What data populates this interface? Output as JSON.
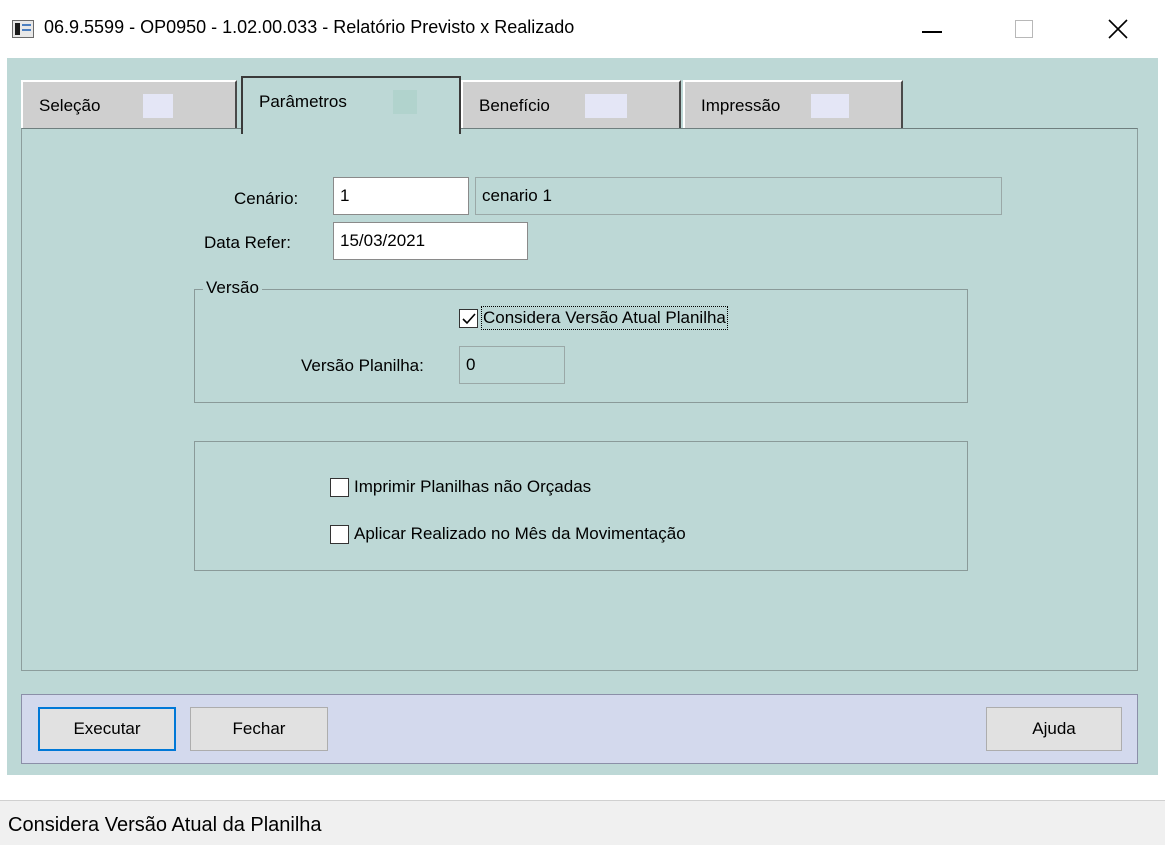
{
  "window": {
    "title": "06.9.5599 - OP0950 - 1.02.00.033 - Relatório Previsto x Realizado",
    "icon": "app-window-icon",
    "controls": [
      "minimize-icon",
      "maximize-icon",
      "close-icon"
    ]
  },
  "tabs": [
    {
      "label": "Seleção",
      "active": false
    },
    {
      "label": "Parâmetros",
      "active": true
    },
    {
      "label": "Benefício",
      "active": false
    },
    {
      "label": "Impressão",
      "active": false
    }
  ],
  "form": {
    "cenario_label": "Cenário:",
    "cenario_value": "1",
    "cenario_desc": "cenario 1",
    "data_refer_label": "Data Refer:",
    "data_refer_value": "15/03/2021"
  },
  "versao_group": {
    "legend": "Versão",
    "considera_label": "Considera Versão Atual Planilha",
    "considera_checked": true,
    "versao_planilha_label": "Versão Planilha:",
    "versao_planilha_value": "0"
  },
  "options_group": {
    "imprimir_label": "Imprimir Planilhas não Orçadas",
    "imprimir_checked": false,
    "aplicar_label": "Aplicar Realizado no Mês da Movimentação",
    "aplicar_checked": false
  },
  "buttons": {
    "executar": "Executar",
    "fechar": "Fechar",
    "ajuda": "Ajuda"
  },
  "status": {
    "text": "Considera Versão Atual da Planilha"
  },
  "colors": {
    "client_bg": "#bdd8d6",
    "tab_inactive": "#cfcfcf",
    "button_bar": "#d3d9ed",
    "default_button_border": "#0078d7"
  }
}
